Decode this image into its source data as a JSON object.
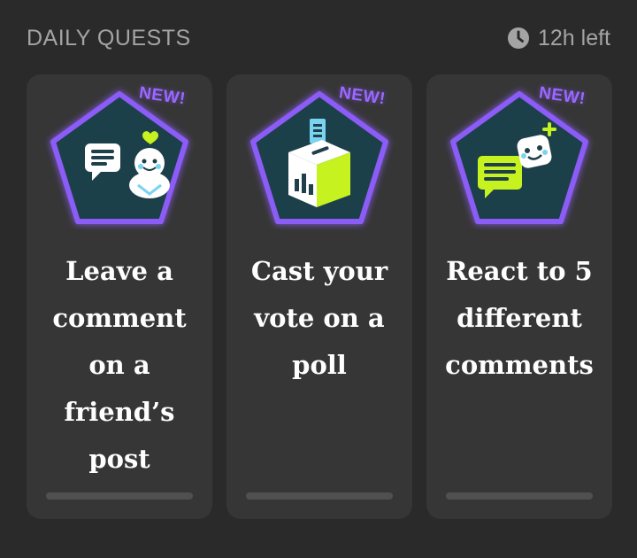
{
  "header": {
    "title": "DAILY QUESTS",
    "time_left": "12h left",
    "icon": "clock-icon"
  },
  "quests": [
    {
      "label": "Leave a comment on a friend’s post",
      "new_tag": "NEW!",
      "icon": "comment-smiley-icon",
      "progress": 0
    },
    {
      "label": "Cast your vote on a poll",
      "new_tag": "NEW!",
      "icon": "ballot-box-icon",
      "progress": 0
    },
    {
      "label": "React to 5 different comments",
      "new_tag": "NEW!",
      "icon": "reaction-emoji-icon",
      "progress": 0
    }
  ],
  "colors": {
    "background": "#2a2a2a",
    "card": "#363636",
    "badge_border": "#8b5cf6",
    "badge_fill": "#1f3f4a",
    "accent_green": "#c6f21f",
    "new_tag": "#9a68ff",
    "progress_track": "#505050"
  }
}
